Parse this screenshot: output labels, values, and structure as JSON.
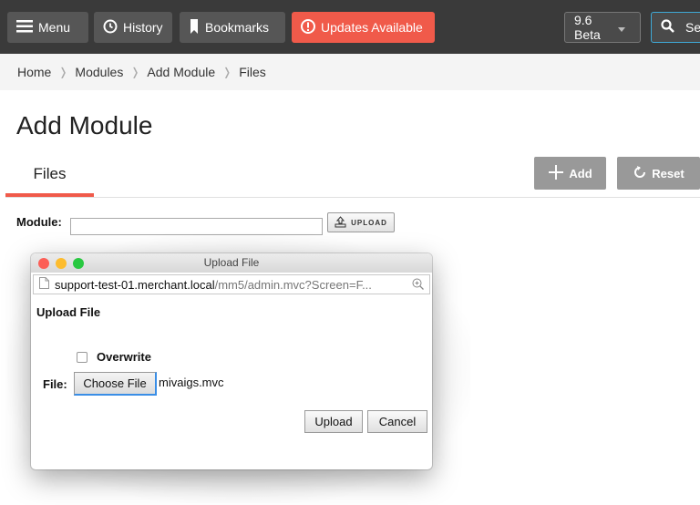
{
  "topbar": {
    "menu_label": "Menu",
    "history_label": "History",
    "bookmarks_label": "Bookmarks",
    "updates_label": "Updates Available",
    "version_label": "9.6 Beta",
    "search_label": "Sea",
    "updates_color": "#f05a4a"
  },
  "breadcrumb": [
    "Home",
    "Modules",
    "Add Module",
    "Files"
  ],
  "page": {
    "title": "Add Module",
    "tab_files": "Files",
    "add_label": "Add",
    "reset_label": "Reset",
    "module_label": "Module:",
    "module_value": "",
    "upload_label": "UPLOAD"
  },
  "dialog": {
    "window_title": "Upload File",
    "url_host": "support-test-01.merchant.local",
    "url_path": "/mm5/admin.mvc?Screen=F...",
    "heading": "Upload File",
    "overwrite_label": "Overwrite",
    "overwrite_checked": false,
    "file_label": "File:",
    "choose_file_label": "Choose File",
    "file_name": "mivaigs.mvc",
    "upload_button": "Upload",
    "cancel_button": "Cancel"
  },
  "icons": {
    "menu": "hamburger-icon",
    "history": "clock-icon",
    "bookmarks": "bookmark-icon",
    "updates": "alert-icon",
    "search": "search-icon",
    "add": "plus-icon",
    "reset": "refresh-icon",
    "upload": "upload-icon",
    "page": "page-icon",
    "zoom": "zoom-icon"
  }
}
